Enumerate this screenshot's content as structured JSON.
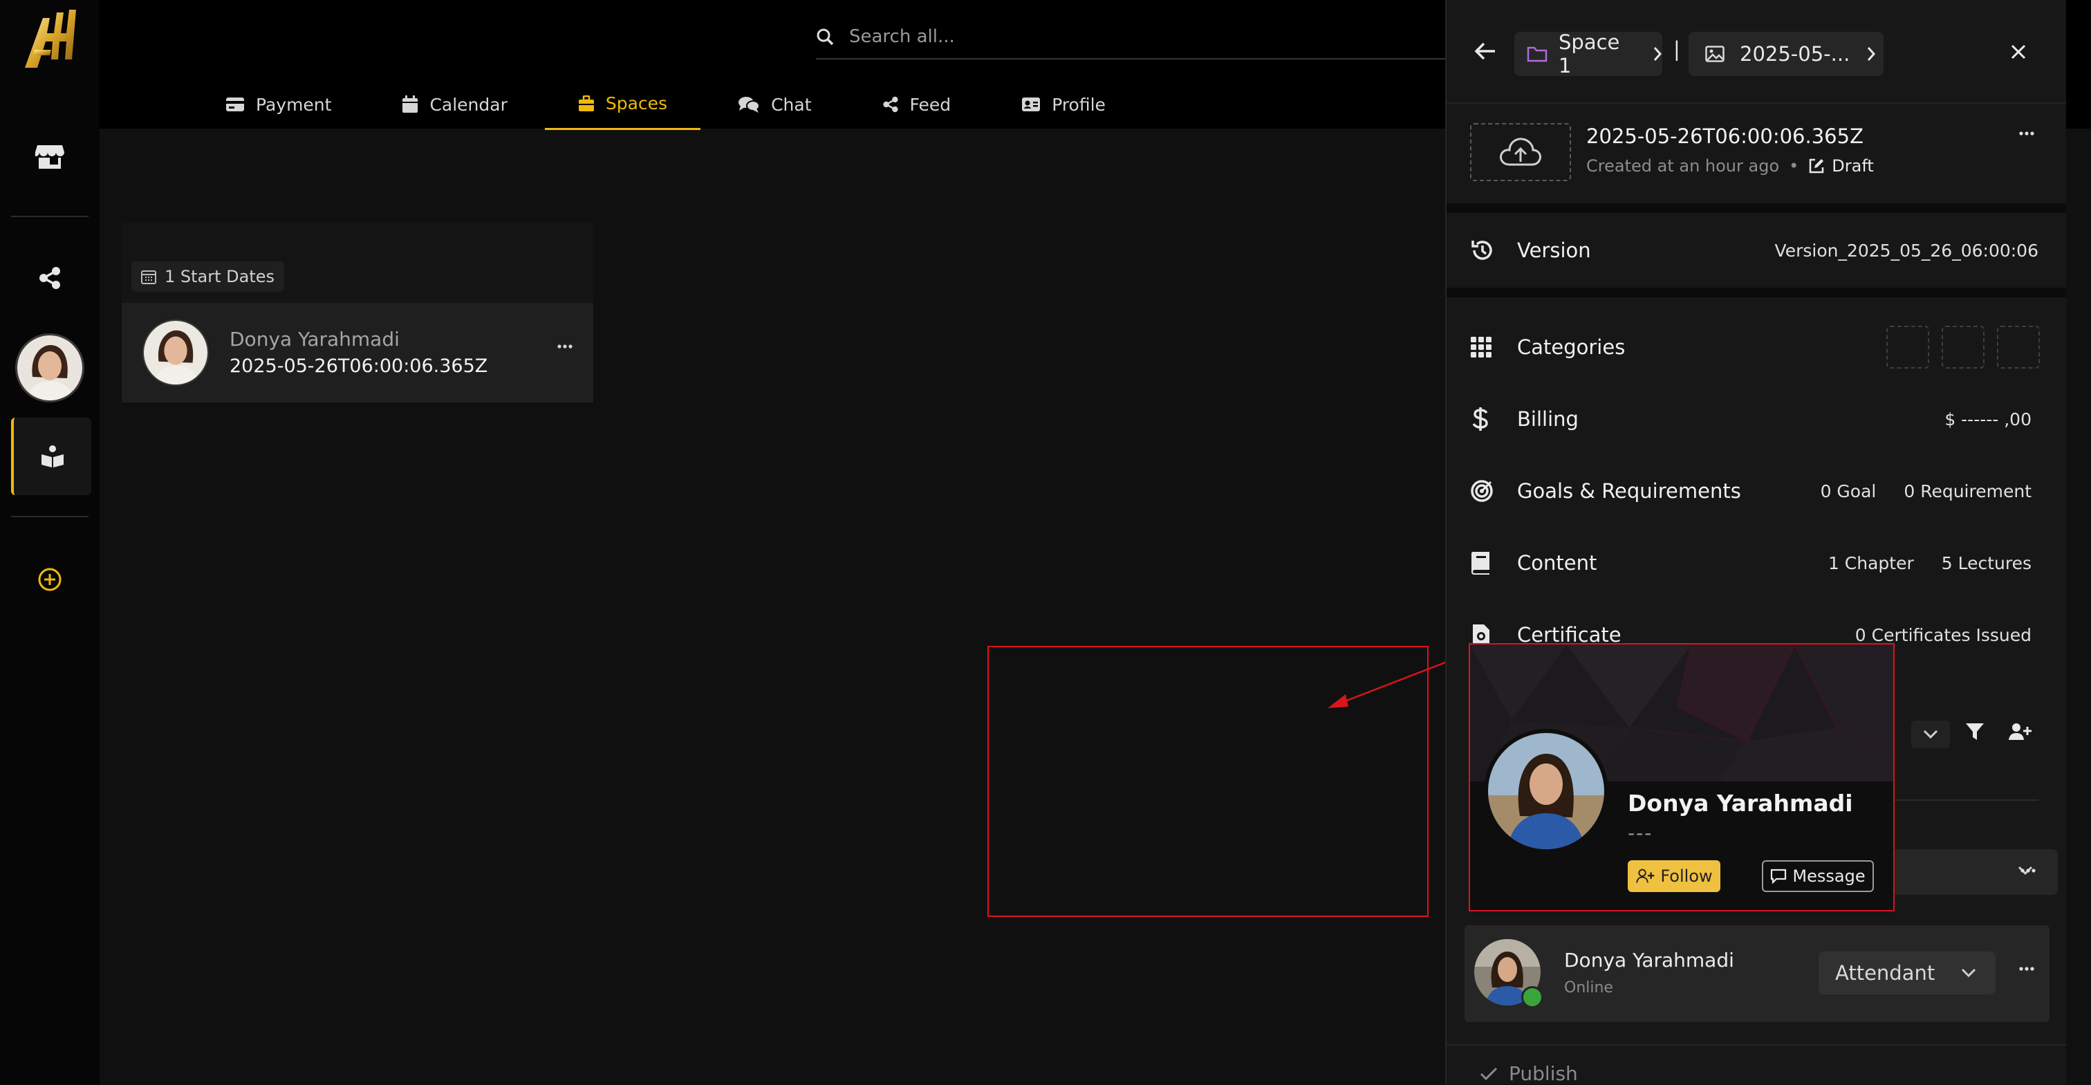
{
  "app": {
    "name": "All",
    "brand_color": "#f0b90b"
  },
  "search": {
    "placeholder": "Search all..."
  },
  "nav": {
    "tabs": [
      {
        "label": "Payment",
        "icon": "credit-card-icon"
      },
      {
        "label": "Calendar",
        "icon": "calendar-icon"
      },
      {
        "label": "Spaces",
        "icon": "briefcase-icon",
        "active": true
      },
      {
        "label": "Chat",
        "icon": "chat-icon"
      },
      {
        "label": "Feed",
        "icon": "share-icon"
      },
      {
        "label": "Profile",
        "icon": "id-card-icon"
      }
    ]
  },
  "rail": {
    "items": [
      "store-icon",
      "share-icon",
      "avatar",
      "spaces-book-icon",
      "add-circle-icon"
    ]
  },
  "start_dates": {
    "badge": "1 Start Dates",
    "row": {
      "name": "Donya Yarahmadi",
      "date": "2025-05-26T06:00:06.365Z"
    }
  },
  "panel": {
    "breadcrumb": {
      "space": "Space 1",
      "separator": "|",
      "item": "2025-05-..."
    },
    "info": {
      "title": "2025-05-26T06:00:06.365Z",
      "created": "Created at an hour ago",
      "bullet": "•",
      "status": "Draft"
    },
    "version": {
      "label": "Version",
      "value": "Version_2025_05_26_06:00:06"
    },
    "categories": {
      "label": "Categories"
    },
    "billing": {
      "label": "Billing",
      "value": "$ ------ ,00"
    },
    "goals": {
      "label": "Goals & Requirements",
      "goal": "0 Goal",
      "requirement": "0 Requirement"
    },
    "content": {
      "label": "Content",
      "chapters": "1 Chapter",
      "lectures": "5 Lectures"
    },
    "certificate": {
      "label": "Certificate",
      "value": "0 Certificates Issued"
    },
    "attendant": {
      "name": "Donya Yarahmadi",
      "status": "Online",
      "role": "Attendant",
      "status_color": "#3aa53a"
    },
    "publish": {
      "label": "Publish"
    }
  },
  "popup": {
    "name": "Donya Yarahmadi",
    "subtitle": "---",
    "follow_label": "Follow",
    "message_label": "Message"
  }
}
